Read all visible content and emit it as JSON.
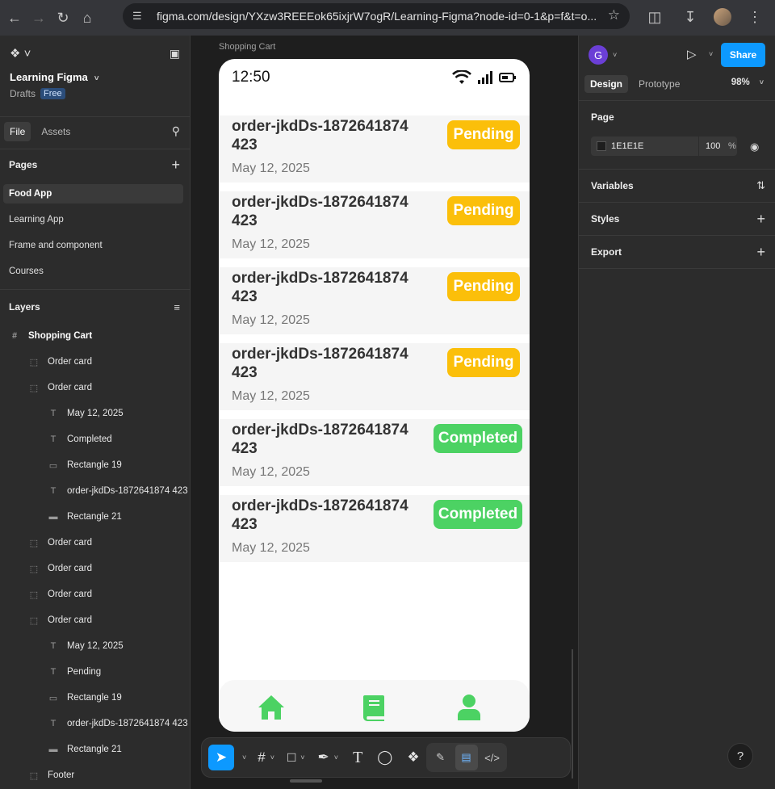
{
  "browser": {
    "url": "figma.com/design/YXzw3REEEok65ixjrW7ogR/Learning-Figma?node-id=0-1&p=f&t=o..."
  },
  "left": {
    "file_name": "Learning Figma",
    "drafts": "Drafts",
    "plan_badge": "Free",
    "tabs": [
      "File",
      "Assets"
    ],
    "pages_title": "Pages",
    "pages": [
      "Food App",
      "Learning App",
      "Frame and component",
      "Courses"
    ],
    "layers_title": "Layers",
    "layers": [
      {
        "label": "Shopping Cart",
        "depth": 0,
        "type": "frame"
      },
      {
        "label": "Order card",
        "depth": 1,
        "type": "group"
      },
      {
        "label": "Order card",
        "depth": 1,
        "type": "group"
      },
      {
        "label": "May 12, 2025",
        "depth": 2,
        "type": "text"
      },
      {
        "label": "Completed",
        "depth": 2,
        "type": "text"
      },
      {
        "label": "Rectangle 19",
        "depth": 2,
        "type": "rect"
      },
      {
        "label": "order-jkdDs-1872641874 423",
        "depth": 2,
        "type": "text"
      },
      {
        "label": "Rectangle 21",
        "depth": 2,
        "type": "line"
      },
      {
        "label": "Order card",
        "depth": 1,
        "type": "group"
      },
      {
        "label": "Order card",
        "depth": 1,
        "type": "group"
      },
      {
        "label": "Order card",
        "depth": 1,
        "type": "group"
      },
      {
        "label": "Order card",
        "depth": 1,
        "type": "group"
      },
      {
        "label": "May 12, 2025",
        "depth": 2,
        "type": "text"
      },
      {
        "label": "Pending",
        "depth": 2,
        "type": "text"
      },
      {
        "label": "Rectangle 19",
        "depth": 2,
        "type": "rect"
      },
      {
        "label": "order-jkdDs-1872641874 423",
        "depth": 2,
        "type": "text"
      },
      {
        "label": "Rectangle 21",
        "depth": 2,
        "type": "line"
      },
      {
        "label": "Footer",
        "depth": 1,
        "type": "group"
      }
    ]
  },
  "canvas": {
    "frame_label": "Shopping Cart",
    "time": "12:50",
    "orders": [
      {
        "id": "order-jkdDs-1872641874 423",
        "date": "May 12, 2025",
        "status": "Pending"
      },
      {
        "id": "order-jkdDs-1872641874 423",
        "date": "May 12, 2025",
        "status": "Pending"
      },
      {
        "id": "order-jkdDs-1872641874 423",
        "date": "May 12, 2025",
        "status": "Pending"
      },
      {
        "id": "order-jkdDs-1872641874 423",
        "date": "May 12, 2025",
        "status": "Pending"
      },
      {
        "id": "order-jkdDs-1872641874 423",
        "date": "May 12, 2025",
        "status": "Completed"
      },
      {
        "id": "order-jkdDs-1872641874 423",
        "date": "May 12, 2025",
        "status": "Completed"
      }
    ],
    "footer_icons": [
      "home-icon",
      "book-icon",
      "user-icon"
    ],
    "colors": {
      "pending": "#fbbf0a",
      "completed": "#4cd263",
      "accent": "#0d99ff"
    }
  },
  "right": {
    "avatar_letter": "G",
    "share": "Share",
    "tabs": [
      "Design",
      "Prototype"
    ],
    "zoom": "98%",
    "page_title": "Page",
    "page_fill_hex": "1E1E1E",
    "page_fill_opacity": "100",
    "page_fill_unit": "%",
    "sections": [
      "Variables",
      "Styles",
      "Export"
    ]
  }
}
